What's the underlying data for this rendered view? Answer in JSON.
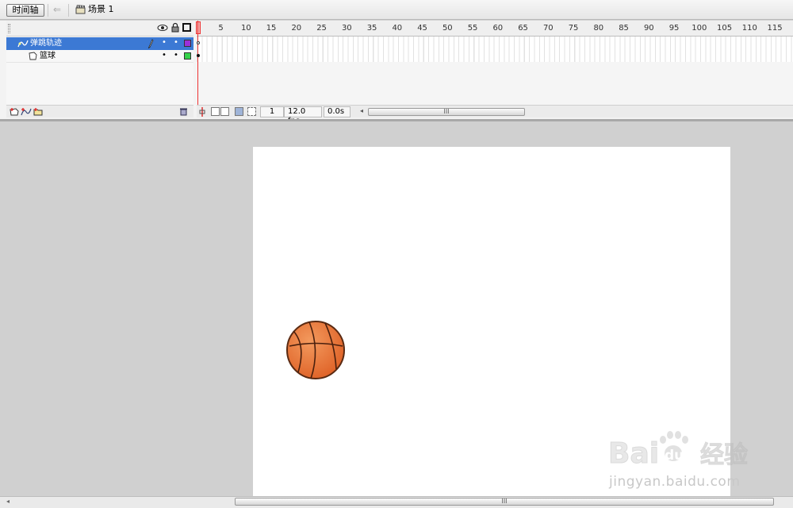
{
  "toolbar": {
    "timeline_button": "时间轴",
    "scene_label": "场景 1"
  },
  "timeline": {
    "layers": [
      {
        "name": "弹跳轨迹",
        "type": "guide",
        "selected": true,
        "color": "#9b30d9"
      },
      {
        "name": "篮球",
        "type": "normal",
        "selected": false,
        "color": "#35d24a"
      }
    ],
    "ruler_ticks": [
      "5",
      "10",
      "15",
      "20",
      "25",
      "30",
      "35",
      "40",
      "45",
      "50",
      "55",
      "60",
      "65",
      "70",
      "75",
      "80",
      "85",
      "90",
      "95",
      "100",
      "105",
      "110",
      "115"
    ],
    "current_frame": "1",
    "frame_rate": "12.0 fps",
    "elapsed_time": "0.0s",
    "scroll_thumb_label": "III"
  },
  "stage": {
    "background": "#ffffff",
    "object": "basketball",
    "ball_color": "#e8743a"
  },
  "bottom_scroll": {
    "thumb_label": "III"
  },
  "watermark": {
    "url_text": "jingyan.baidu.com",
    "logo_text": "Bai du 经验"
  }
}
